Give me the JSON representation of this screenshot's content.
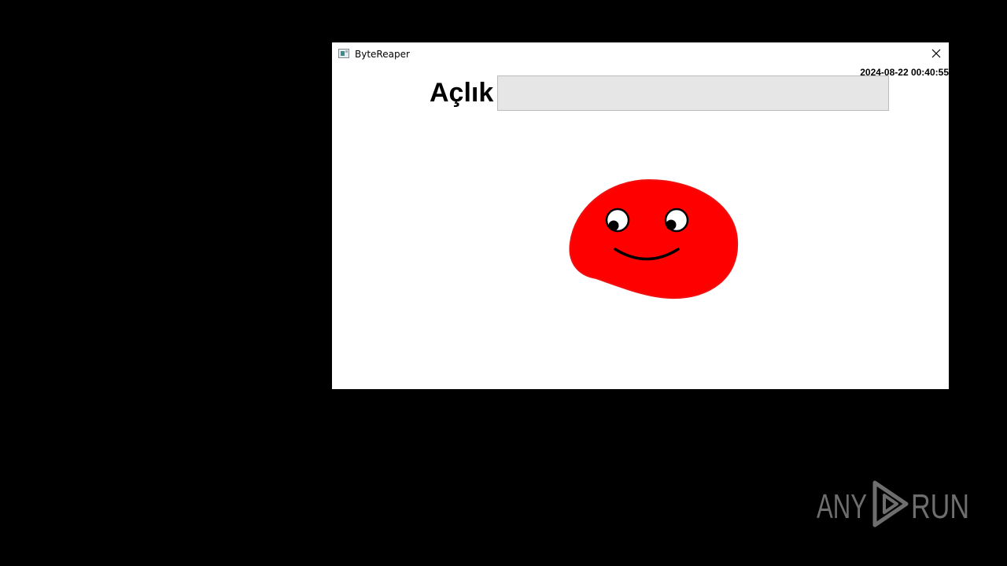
{
  "window": {
    "title": "ByteReaper",
    "close_label": "×"
  },
  "status": {
    "timestamp": "2024-08-22 00:40:55"
  },
  "hunger": {
    "label": "Açlık",
    "fill_percent": 0
  },
  "pet": {
    "body_color": "#ff0000",
    "expression": "smiling"
  },
  "watermark": {
    "text_left": "ANY",
    "text_right": "RUN"
  },
  "colors": {
    "desktop_bg": "#000000",
    "window_bg": "#ffffff",
    "bar_bg": "#e6e6e6",
    "bar_fill": "#06b025",
    "watermark": "#6e6e6e"
  }
}
